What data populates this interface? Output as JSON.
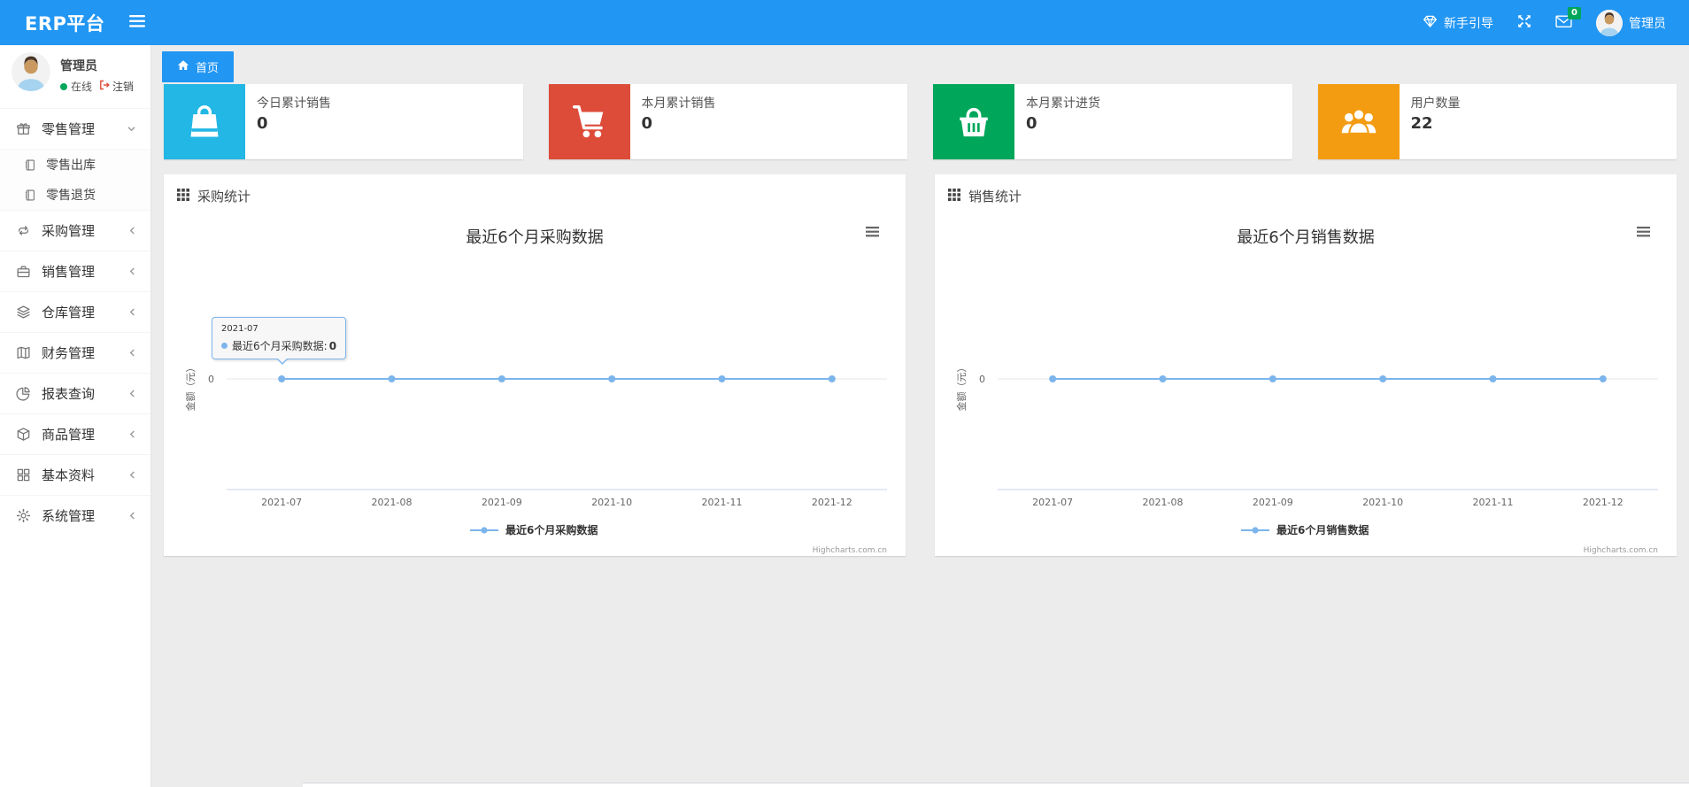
{
  "navbar": {
    "brand": "ERP平台",
    "guide_label": "新手引导",
    "mail_badge": "0",
    "user_name": "管理员"
  },
  "sidebar": {
    "user": {
      "name": "管理员",
      "status": "在线",
      "logout": "注销"
    },
    "menu": [
      {
        "key": "retail",
        "label": "零售管理",
        "icon": "gift-icon",
        "expanded": true,
        "children": [
          {
            "key": "retail-outbound",
            "label": "零售出库",
            "icon": "journal-icon"
          },
          {
            "key": "retail-return",
            "label": "零售退货",
            "icon": "journal-icon"
          }
        ]
      },
      {
        "key": "purchase",
        "label": "采购管理",
        "icon": "repeat-icon"
      },
      {
        "key": "sales",
        "label": "销售管理",
        "icon": "briefcase-icon"
      },
      {
        "key": "warehouse",
        "label": "仓库管理",
        "icon": "layers-icon"
      },
      {
        "key": "finance",
        "label": "财务管理",
        "icon": "ledger-icon"
      },
      {
        "key": "report",
        "label": "报表查询",
        "icon": "pie-chart-icon"
      },
      {
        "key": "product",
        "label": "商品管理",
        "icon": "cube-icon"
      },
      {
        "key": "basic-data",
        "label": "基本资料",
        "icon": "grid-icon"
      },
      {
        "key": "system",
        "label": "系统管理",
        "icon": "gear-icon"
      }
    ]
  },
  "tab_bar": {
    "tabs": [
      {
        "label": "首页",
        "active": true
      }
    ]
  },
  "stat_cards": [
    {
      "key": "today-sales",
      "label": "今日累计销售",
      "value": "0",
      "color": "#23b7e5",
      "icon": "bag-icon"
    },
    {
      "key": "month-sales",
      "label": "本月累计销售",
      "value": "0",
      "color": "#dd4b39",
      "icon": "cart-icon"
    },
    {
      "key": "month-purchase",
      "label": "本月累计进货",
      "value": "0",
      "color": "#00a65a",
      "icon": "basket-icon"
    },
    {
      "key": "user-count",
      "label": "用户数量",
      "value": "22",
      "color": "#f39c12",
      "icon": "users-icon"
    }
  ],
  "panels": [
    {
      "header": "采购统计"
    },
    {
      "header": "销售统计"
    }
  ],
  "chart_data": [
    {
      "type": "line",
      "title": "最近6个月采购数据",
      "categories": [
        "2021-07",
        "2021-08",
        "2021-09",
        "2021-10",
        "2021-11",
        "2021-12"
      ],
      "series": [
        {
          "name": "最近6个月采购数据",
          "values": [
            0,
            0,
            0,
            0,
            0,
            0
          ]
        }
      ],
      "xlabel": "",
      "ylabel": "金额（元）",
      "yticks": [
        0
      ],
      "ylim": [
        0,
        1
      ],
      "grid": true,
      "legend_position": "bottom",
      "line_color": "#7cb5ec",
      "credits": "Highcharts.com.cn"
    },
    {
      "type": "line",
      "title": "最近6个月销售数据",
      "categories": [
        "2021-07",
        "2021-08",
        "2021-09",
        "2021-10",
        "2021-11",
        "2021-12"
      ],
      "series": [
        {
          "name": "最近6个月销售数据",
          "values": [
            0,
            0,
            0,
            0,
            0,
            0
          ]
        }
      ],
      "xlabel": "",
      "ylabel": "金额（元）",
      "yticks": [
        0
      ],
      "ylim": [
        0,
        1
      ],
      "grid": true,
      "legend_position": "bottom",
      "line_color": "#7cb5ec",
      "credits": "Highcharts.com.cn"
    }
  ],
  "tooltip": {
    "header": "2021-07",
    "series_name": "最近6个月采购数据",
    "value": "0"
  }
}
